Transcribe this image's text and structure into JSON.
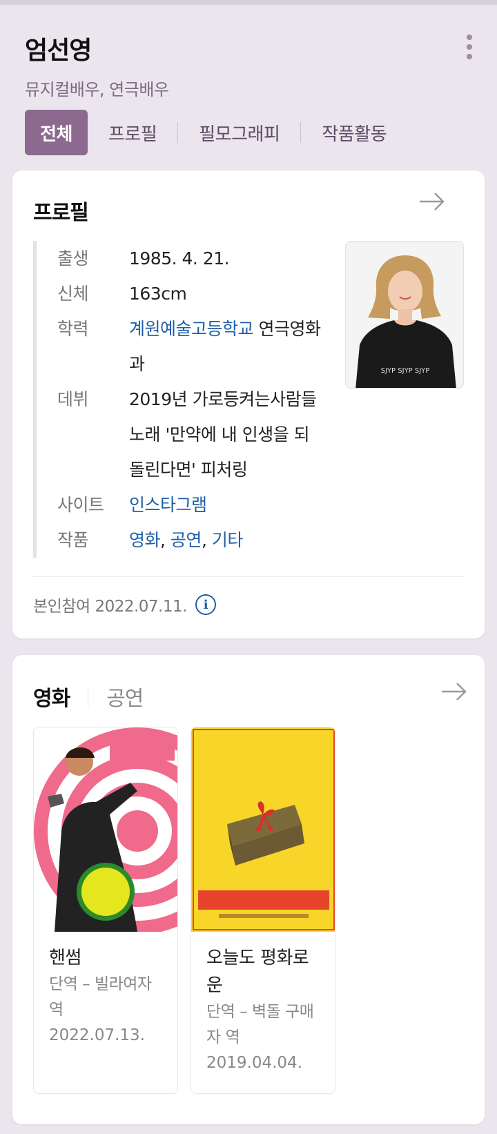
{
  "header": {
    "name": "엄선영",
    "subtitle": "뮤지컬배우, 연극배우",
    "tabs": [
      {
        "label": "전체",
        "active": true
      },
      {
        "label": "프로필",
        "active": false
      },
      {
        "label": "필모그래피",
        "active": false
      },
      {
        "label": "작품활동",
        "active": false
      }
    ]
  },
  "profile": {
    "title": "프로필",
    "rows": {
      "birth": {
        "key": "출생",
        "value": "1985. 4. 21."
      },
      "body": {
        "key": "신체",
        "value": "163cm"
      },
      "edu": {
        "key": "학력",
        "school": "계원예술고등학교",
        "rest": " 연극영화과"
      },
      "debut": {
        "key": "데뷔",
        "value": "2019년 가로등켜는사람들 노래 '만약에 내 인생을 되돌린다면' 피처링"
      },
      "site": {
        "key": "사이트",
        "value": "인스타그램"
      },
      "works": {
        "key": "작품",
        "items": [
          "영화",
          "공연",
          "기타"
        ],
        "sep": ", "
      }
    },
    "owner_note": "본인참여 2022.07.11.",
    "info_icon": "i"
  },
  "movies_section": {
    "tabs": [
      {
        "label": "영화",
        "active": true
      },
      {
        "label": "공연",
        "active": false
      }
    ],
    "items": [
      {
        "title": "핸썸",
        "role": "단역 – 빌라여자 역",
        "date": "2022.07.13."
      },
      {
        "title": "오늘도 평화로운",
        "role": "단역 – 벽돌 구매자 역",
        "date": "2019.04.04."
      }
    ]
  },
  "colors": {
    "background": "#ebe5ee",
    "accent": "#8c6a8f",
    "link": "#1f5fa8"
  },
  "icons": [
    "more-vertical-icon",
    "arrow-right-icon",
    "info-icon"
  ]
}
